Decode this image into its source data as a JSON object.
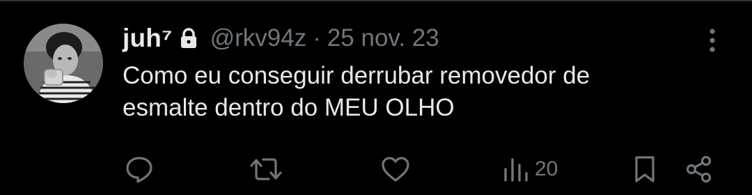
{
  "tweet": {
    "display_name": "juh⁷",
    "handle": "@rkv94z",
    "separator": "·",
    "timestamp": "25 nov. 23",
    "text_lines": [
      "Como eu conseguir derrubar removedor de",
      "esmalte dentro do MEU OLHO"
    ],
    "protected_icon": "lock-icon",
    "more_icon": "more-vertical-icon"
  },
  "actions": {
    "reply": {
      "icon": "reply-icon",
      "count": ""
    },
    "retweet": {
      "icon": "retweet-icon",
      "count": ""
    },
    "like": {
      "icon": "heart-icon",
      "count": ""
    },
    "views": {
      "icon": "views-icon",
      "count": "20"
    },
    "bookmark": {
      "icon": "bookmark-icon",
      "count": ""
    },
    "share": {
      "icon": "share-icon",
      "count": ""
    }
  },
  "colors": {
    "background": "#000000",
    "primary_text": "#e7e9ea",
    "secondary_text": "#71767b",
    "divider": "#2f3336"
  }
}
